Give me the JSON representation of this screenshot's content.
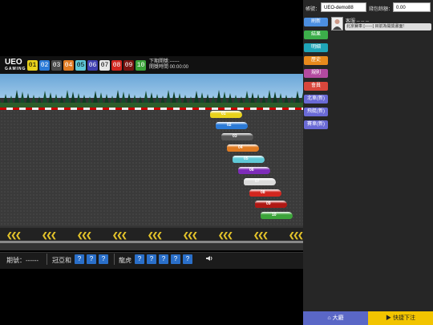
{
  "header": {
    "logo_main": "UEO",
    "logo_sub": "GAMING",
    "ranks": [
      {
        "n": "01",
        "bg": "#e8d21c",
        "fg": "#000"
      },
      {
        "n": "02",
        "bg": "#2b7ad6",
        "fg": "#fff"
      },
      {
        "n": "03",
        "bg": "#4a4a4a",
        "fg": "#fff"
      },
      {
        "n": "04",
        "bg": "#e07b22",
        "fg": "#fff"
      },
      {
        "n": "05",
        "bg": "#5fc9d8",
        "fg": "#000"
      },
      {
        "n": "06",
        "bg": "#3f3fb0",
        "fg": "#fff"
      },
      {
        "n": "07",
        "bg": "#e6e6e6",
        "fg": "#000"
      },
      {
        "n": "08",
        "bg": "#d2261f",
        "fg": "#fff"
      },
      {
        "n": "09",
        "bg": "#7a1411",
        "fg": "#fff"
      },
      {
        "n": "10",
        "bg": "#3ca43a",
        "fg": "#fff"
      }
    ],
    "next_period": "下期開獎:------",
    "open_time": "開獎時間 00:00:00"
  },
  "cars": [
    {
      "num": "01",
      "color": "#e8d21c"
    },
    {
      "num": "02",
      "color": "#2b7ad6"
    },
    {
      "num": "03",
      "color": "#555555"
    },
    {
      "num": "04",
      "color": "#e07b22"
    },
    {
      "num": "05",
      "color": "#5fc9d8"
    },
    {
      "num": "06",
      "color": "#7d2bb8"
    },
    {
      "num": "07",
      "color": "#dcdcdc"
    },
    {
      "num": "08",
      "color": "#d2261f"
    },
    {
      "num": "09",
      "color": "#b01814"
    },
    {
      "num": "10",
      "color": "#3ca43a"
    }
  ],
  "bottom": {
    "period_label": "期號：------",
    "champion_label": "冠亞和",
    "champion_values": [
      "?",
      "?",
      "?"
    ],
    "dragon_label": "龍虎",
    "dragon_values": [
      "?",
      "?",
      "?",
      "?",
      "?"
    ],
    "speaker_icon": "speaker-icon"
  },
  "panel": {
    "account_label": "帳號：",
    "account_value": "UEO-demo88",
    "balance_label": "錢包餘額：",
    "balance_value": "0.00",
    "service_label": "客服 -- -- --",
    "notice_text": "北京賽車 [------] 目前為開獎畫面！",
    "menu": [
      {
        "label": "刷新",
        "color": "#4c8fe0"
      },
      {
        "label": "結果",
        "color": "#3cae4a"
      },
      {
        "label": "明細",
        "color": "#1fa5b8"
      },
      {
        "label": "歷史",
        "color": "#e88a1c"
      },
      {
        "label": "規則",
        "color": "#b34aa0"
      },
      {
        "label": "會員",
        "color": "#d9473c"
      },
      {
        "label": "北車(新)",
        "color": "#6a6ad6"
      },
      {
        "label": "飛艇(新)",
        "color": "#6a6ad6"
      },
      {
        "label": "賽車(新)",
        "color": "#6a6ad6"
      }
    ],
    "lobby": "大廳",
    "quick_bet": "快捷下注"
  }
}
